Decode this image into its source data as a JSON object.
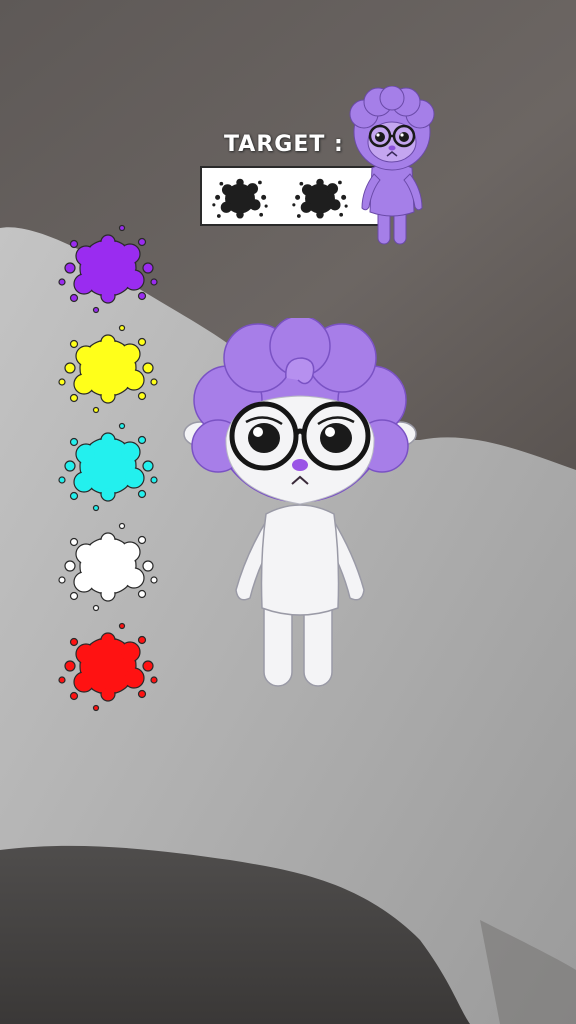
{
  "target": {
    "label": "TARGET :",
    "slots": [
      {
        "color": "#1e1e1e",
        "icon": "splat-icon"
      },
      {
        "color": "#1e1e1e",
        "icon": "splat-icon"
      }
    ],
    "preview_colors": {
      "hair": "#a57fe8",
      "body": "#a57fe8",
      "nose": "#8a4fd8"
    }
  },
  "palette": [
    {
      "name": "purple",
      "color": "#9a2cf0",
      "icon": "splat-icon"
    },
    {
      "name": "yellow",
      "color": "#ffff1a",
      "icon": "splat-icon"
    },
    {
      "name": "cyan",
      "color": "#23f0ee",
      "icon": "splat-icon"
    },
    {
      "name": "white",
      "color": "#ffffff",
      "icon": "splat-icon"
    },
    {
      "name": "red",
      "color": "#ff1212",
      "icon": "splat-icon"
    }
  ],
  "character": {
    "hair_color": "#a77ee8",
    "body_color": "#f4f4f6",
    "nose_color": "#9a55e6",
    "glasses_color": "#151515",
    "ear_inner_color": "#f4b6c4"
  }
}
